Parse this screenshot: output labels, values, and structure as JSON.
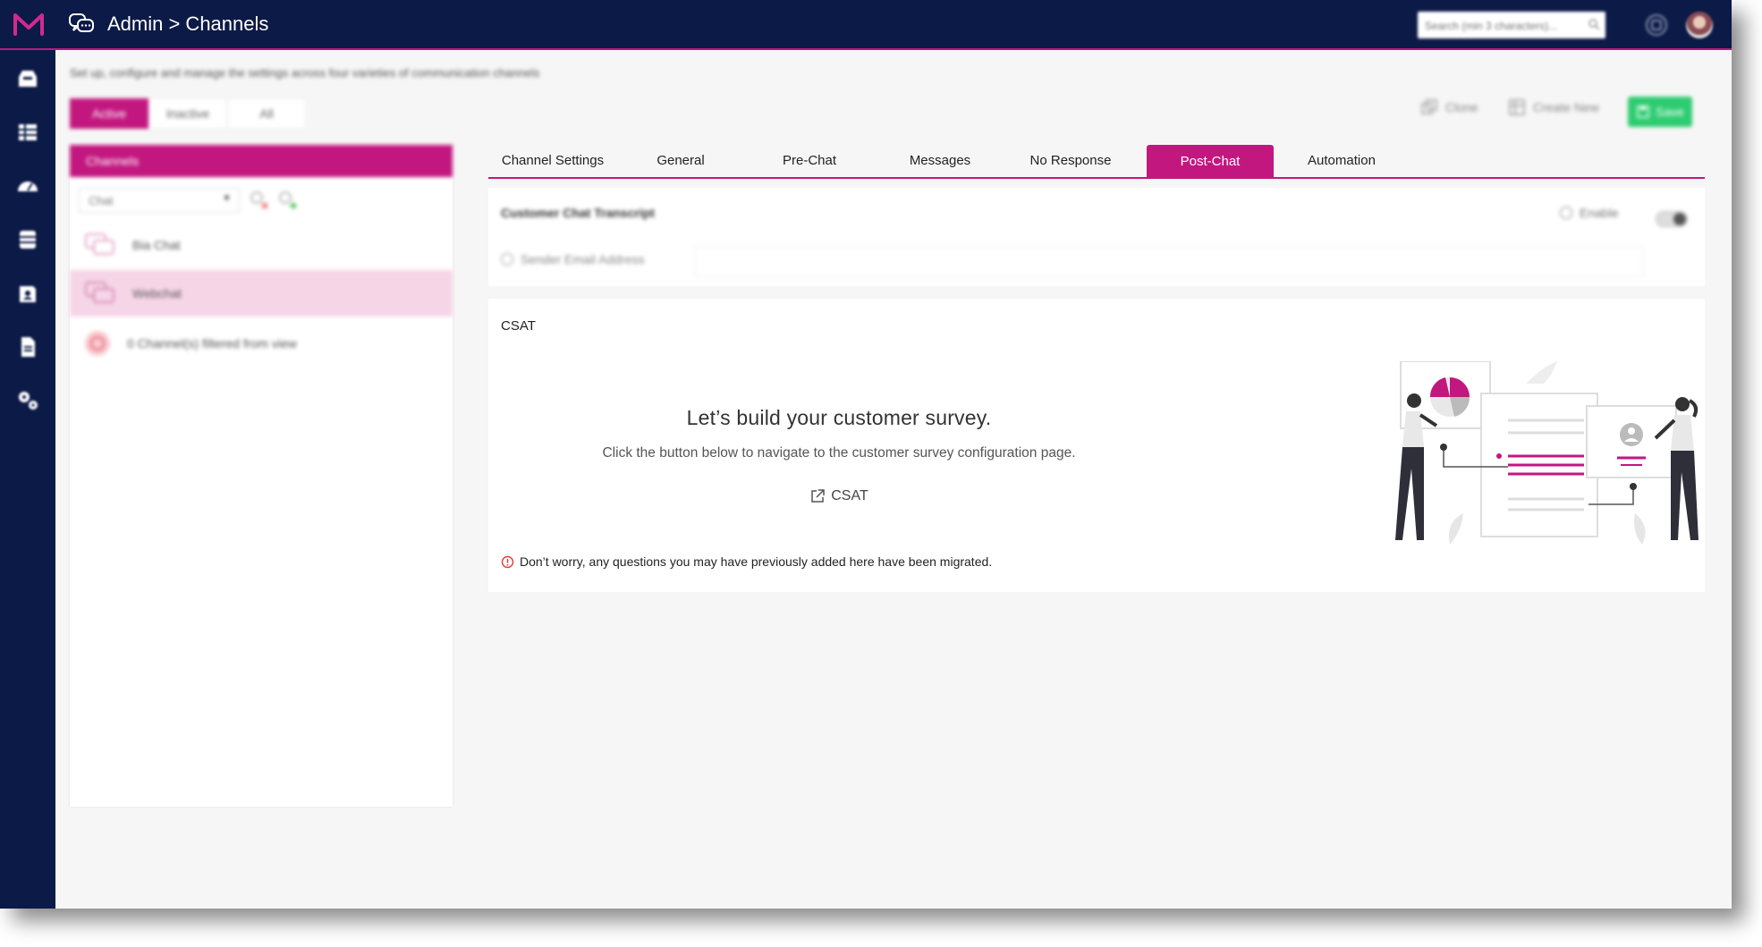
{
  "header": {
    "title": "Admin > Channels",
    "search_placeholder": "Search (min 3 characters)..."
  },
  "page": {
    "description": "Set up, configure and manage the settings across four varieties of communication channels",
    "filter_tabs": [
      "Active",
      "Inactive",
      "All"
    ],
    "actions": {
      "clone": "Clone",
      "create_new": "Create New",
      "save": "Save"
    }
  },
  "channels_panel": {
    "heading": "Channels",
    "type_select": "Chat",
    "items": [
      {
        "label": "Bia Chat",
        "selected": false
      },
      {
        "label": "Webchat",
        "selected": true
      }
    ],
    "filtered_note": "0 Channel(s) filtered from view"
  },
  "tabs": [
    {
      "label": "Channel Settings",
      "active": false
    },
    {
      "label": "General",
      "active": false
    },
    {
      "label": "Pre-Chat",
      "active": false
    },
    {
      "label": "Messages",
      "active": false
    },
    {
      "label": "No Response",
      "active": false
    },
    {
      "label": "Post-Chat",
      "active": true
    },
    {
      "label": "Automation",
      "active": false
    }
  ],
  "transcript": {
    "heading": "Customer Chat Transcript",
    "enable_label": "Enable",
    "sender_email_label": "Sender Email Address",
    "sender_email_value": ""
  },
  "csat": {
    "label": "CSAT",
    "title": "Let’s build your customer survey.",
    "description": "Click the button below to navigate to the customer survey configuration page.",
    "link_label": "CSAT",
    "notice": "Don’t worry, any questions you may have previously added here have been migrated."
  },
  "colors": {
    "navy": "#0c1a47",
    "accent": "#c2177f",
    "save_green": "#2ecc71",
    "selected_row": "#f6d5e7"
  }
}
